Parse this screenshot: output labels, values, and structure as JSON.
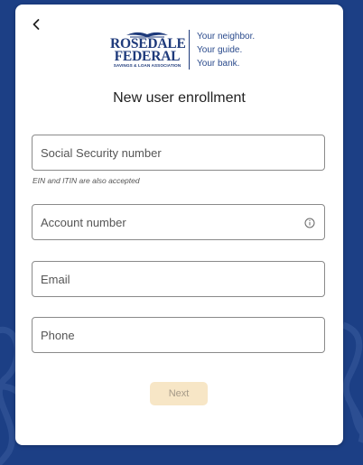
{
  "back": {
    "icon": "chevron-left-icon"
  },
  "logo": {
    "name_line1": "ROSEDALE",
    "name_line2": "FEDERAL",
    "subtitle": "SAVINGS & LOAN ASSOCIATION",
    "tagline": [
      "Your neighbor.",
      "Your guide.",
      "Your bank."
    ]
  },
  "title": "New user enrollment",
  "fields": {
    "ssn": {
      "placeholder": "Social Security number",
      "value": "",
      "hint": "EIN and ITIN are also accepted"
    },
    "account": {
      "placeholder": "Account number",
      "value": "",
      "icon": "info-icon"
    },
    "email": {
      "placeholder": "Email",
      "value": ""
    },
    "phone": {
      "placeholder": "Phone",
      "value": ""
    }
  },
  "next_button": {
    "label": "Next",
    "state": "disabled"
  },
  "colors": {
    "background": "#1c3f85",
    "brand_navy": "#1e3a7b",
    "button_disabled_bg": "#f7e6c6",
    "button_disabled_text": "#a59a88"
  }
}
